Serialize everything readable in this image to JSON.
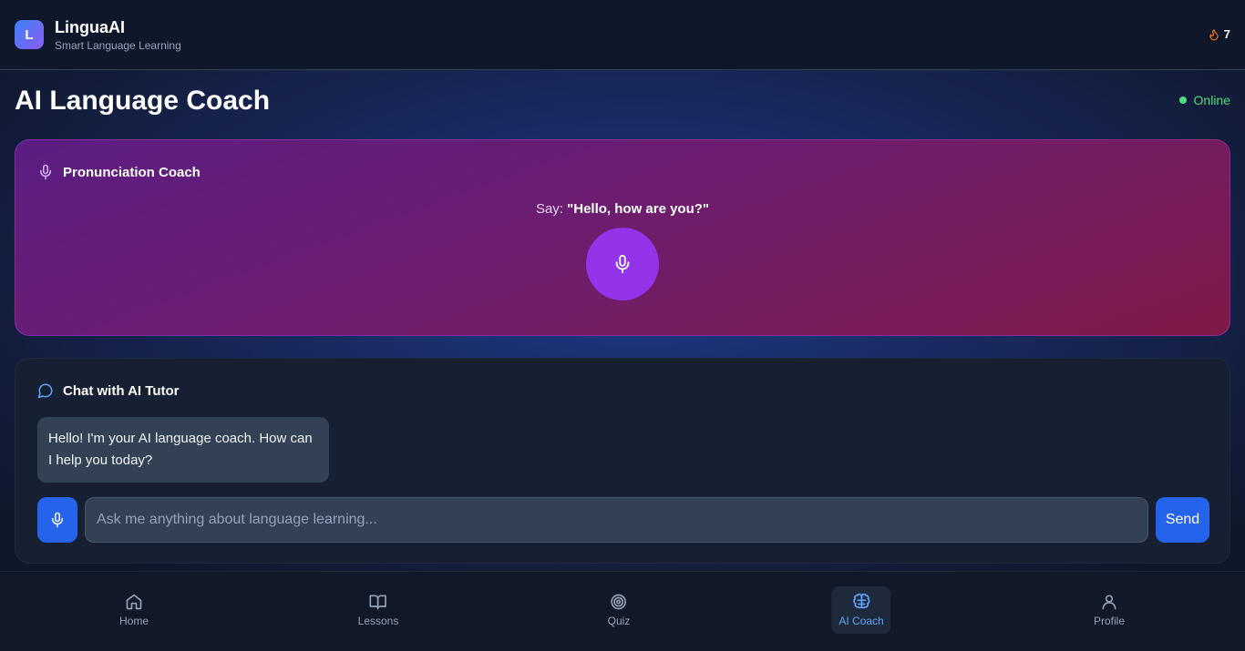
{
  "app": {
    "logo_letter": "L",
    "name": "LinguaAI",
    "tagline": "Smart Language Learning",
    "streak_count": "7"
  },
  "page": {
    "title": "AI Language Coach",
    "status": "Online"
  },
  "pronunciation": {
    "title": "Pronunciation Coach",
    "say_prefix": "Say:",
    "phrase": "\"Hello, how are you?\""
  },
  "chat": {
    "title": "Chat with AI Tutor",
    "messages": [
      {
        "sender": "ai",
        "text": "Hello! I'm your AI language coach. How can I help you today?"
      }
    ],
    "input_placeholder": "Ask me anything about language learning...",
    "input_value": "",
    "send_label": "Send"
  },
  "nav": {
    "items": [
      {
        "label": "Home",
        "icon": "home-icon",
        "active": false
      },
      {
        "label": "Lessons",
        "icon": "book-icon",
        "active": false
      },
      {
        "label": "Quiz",
        "icon": "target-icon",
        "active": false
      },
      {
        "label": "AI Coach",
        "icon": "brain-icon",
        "active": true
      },
      {
        "label": "Profile",
        "icon": "user-icon",
        "active": false
      }
    ]
  },
  "colors": {
    "accent": "#2563eb",
    "mic_purple": "#9333ea",
    "online_green": "#4ade80",
    "active_nav": "#60a5fa",
    "streak_orange": "#f97316"
  }
}
